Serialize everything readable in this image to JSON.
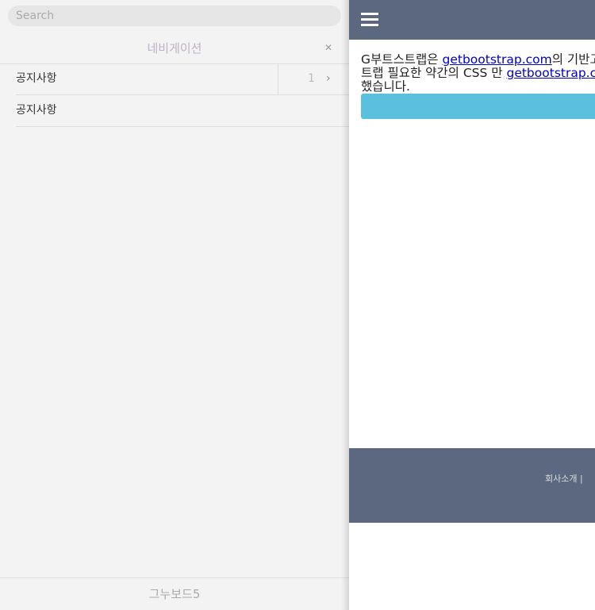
{
  "sidebar": {
    "search_placeholder": "Search",
    "title": "네비게이션",
    "close_glyph": "✕",
    "items": [
      {
        "label": "공지사항",
        "count": "1"
      },
      {
        "label": "공지사항"
      }
    ],
    "footer": "그누보드5"
  },
  "main": {
    "line1_a": "G부트스트랩은 ",
    "link1": "getbootstrap.com",
    "line1_b": "의 기반고",
    "line2_a": "트랩 필요한 약간의 CSS 만 ",
    "link2": "getbootstrap.c",
    "line3": "했습니다."
  },
  "footer": {
    "link1": "회사소개",
    "sep": " | "
  }
}
